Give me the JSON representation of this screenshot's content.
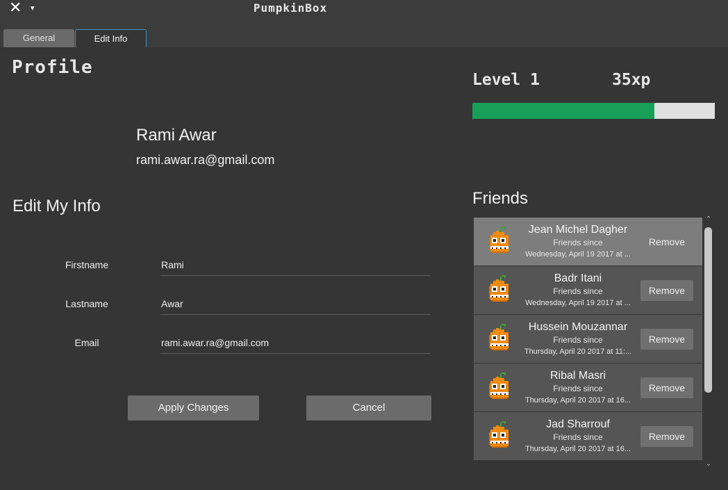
{
  "window": {
    "close_glyph": "✕",
    "menu_glyph": "▾",
    "title": "PumpkinBox"
  },
  "tabs": [
    {
      "label": "General",
      "active": false
    },
    {
      "label": "Edit Info",
      "active": true
    }
  ],
  "profile": {
    "heading": "Profile",
    "name": "Rami Awar",
    "email": "rami.awar.ra@gmail.com"
  },
  "level": {
    "label": "Level 1",
    "xp": "35xp",
    "progress_fraction": 0.75,
    "fill_color": "#18a058"
  },
  "edit": {
    "heading": "Edit My Info",
    "fields": [
      {
        "label": "Firstname",
        "value": "Rami"
      },
      {
        "label": "Lastname",
        "value": "Awar"
      },
      {
        "label": "Email",
        "value": "rami.awar.ra@gmail.com"
      }
    ],
    "apply_label": "Apply Changes",
    "cancel_label": "Cancel"
  },
  "friends": {
    "heading": "Friends",
    "remove_label": "Remove",
    "since_label": "Friends since",
    "items": [
      {
        "name": "Jean Michel Dagher",
        "date": "Wednesday, April 19 2017 at ...",
        "selected": true
      },
      {
        "name": "Badr Itani",
        "date": "Wednesday, April 19 2017 at ...",
        "selected": false
      },
      {
        "name": "Hussein Mouzannar",
        "date": "Thursday, April 20 2017 at 11:...",
        "selected": false
      },
      {
        "name": "Ribal Masri",
        "date": "Thursday, April 20 2017 at 16...",
        "selected": false
      },
      {
        "name": "Jad Sharrouf",
        "date": "Thursday, April 20 2017 at 16...",
        "selected": false
      }
    ]
  },
  "scroll": {
    "up_glyph": "⌃",
    "down_glyph": "⌄"
  }
}
